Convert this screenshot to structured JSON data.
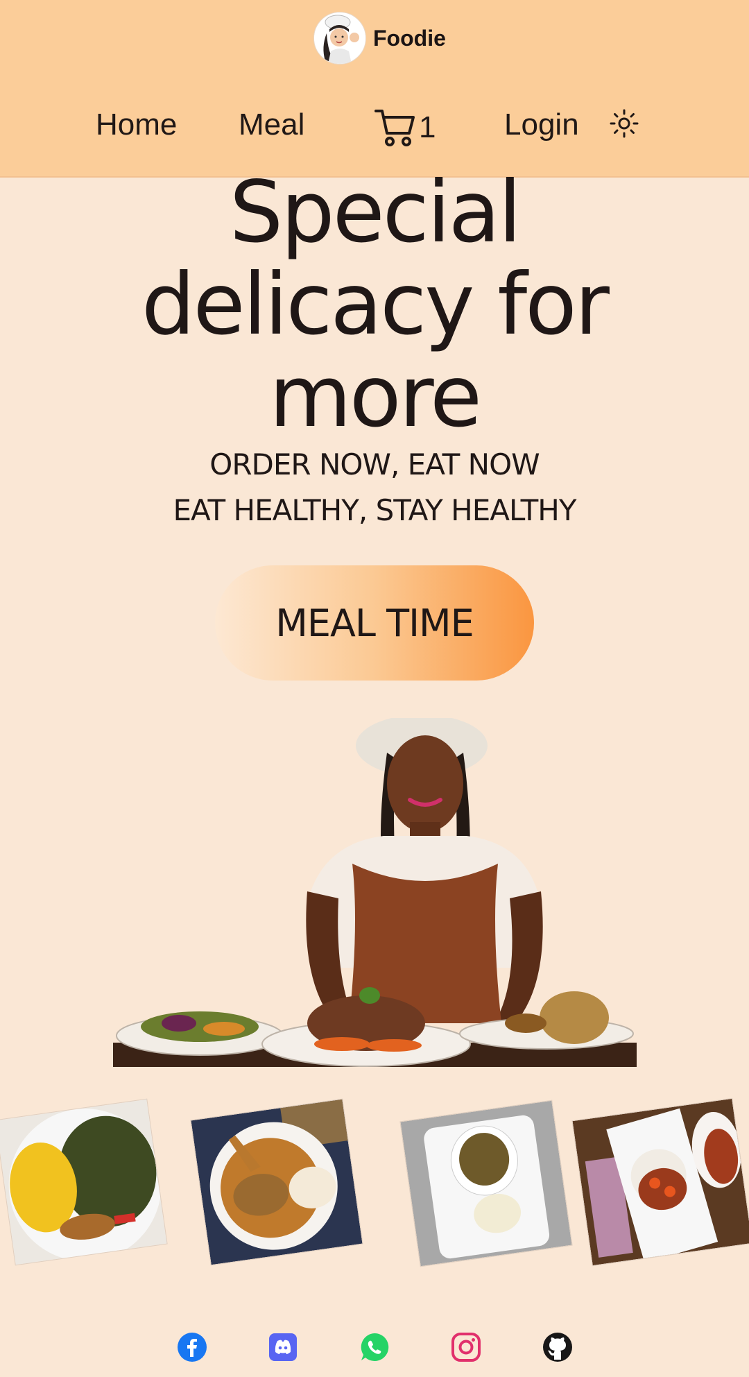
{
  "brand": {
    "name": "Foodie",
    "logo_icon": "chef-avatar-icon"
  },
  "nav": {
    "home": "Home",
    "meal": "Meal",
    "cart_count": "1",
    "login": "Login",
    "theme_icon": "sun-icon"
  },
  "hero": {
    "title_line1": "Special",
    "title_line2": "delicacy for",
    "title_line3": "more",
    "tagline1": "ORDER NOW, EAT NOW",
    "tagline2": "EAT HEALTHY, STAY HEALTHY",
    "cta": "MEAL TIME"
  },
  "gallery": {
    "items": [
      "egusi-soup-with-pounded-yam",
      "egusi-soup-with-meat",
      "soup-bowl-with-fufu",
      "jollof-stew-with-rice"
    ]
  },
  "socials": [
    "facebook-icon",
    "discord-icon",
    "whatsapp-icon",
    "instagram-icon",
    "github-icon"
  ],
  "colors": {
    "header_bg": "#fbcd99",
    "page_bg": "#fae7d5",
    "cta_gradient_end": "#fa9640",
    "facebook": "#1877f2",
    "discord": "#5865f2",
    "whatsapp": "#25d366",
    "instagram": "#e1306c",
    "github": "#181717"
  }
}
